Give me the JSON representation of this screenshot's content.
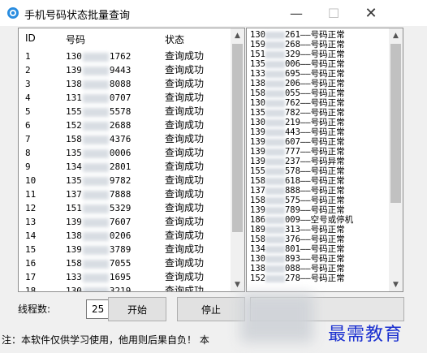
{
  "window": {
    "title": "手机号码状态批量查询"
  },
  "left_table": {
    "headers": {
      "id": "ID",
      "number": "号码",
      "status": "状态"
    },
    "rows": [
      {
        "id": "1",
        "prefix": "130",
        "suffix": "1762",
        "status": "查询成功"
      },
      {
        "id": "2",
        "prefix": "139",
        "suffix": "9443",
        "status": "查询成功"
      },
      {
        "id": "3",
        "prefix": "138",
        "suffix": "8088",
        "status": "查询成功"
      },
      {
        "id": "4",
        "prefix": "131",
        "suffix": "0707",
        "status": "查询成功"
      },
      {
        "id": "5",
        "prefix": "155",
        "suffix": "5578",
        "status": "查询成功"
      },
      {
        "id": "6",
        "prefix": "152",
        "suffix": "2688",
        "status": "查询成功"
      },
      {
        "id": "7",
        "prefix": "158",
        "suffix": "4376",
        "status": "查询成功"
      },
      {
        "id": "8",
        "prefix": "135",
        "suffix": "0006",
        "status": "查询成功"
      },
      {
        "id": "9",
        "prefix": "134",
        "suffix": "2801",
        "status": "查询成功"
      },
      {
        "id": "10",
        "prefix": "135",
        "suffix": "9782",
        "status": "查询成功"
      },
      {
        "id": "11",
        "prefix": "137",
        "suffix": "7888",
        "status": "查询成功"
      },
      {
        "id": "12",
        "prefix": "151",
        "suffix": "5329",
        "status": "查询成功"
      },
      {
        "id": "13",
        "prefix": "139",
        "suffix": "7607",
        "status": "查询成功"
      },
      {
        "id": "14",
        "prefix": "138",
        "suffix": "0206",
        "status": "查询成功"
      },
      {
        "id": "15",
        "prefix": "139",
        "suffix": "3789",
        "status": "查询成功"
      },
      {
        "id": "16",
        "prefix": "158",
        "suffix": "7055",
        "status": "查询成功"
      },
      {
        "id": "17",
        "prefix": "133",
        "suffix": "1695",
        "status": "查询成功"
      },
      {
        "id": "18",
        "prefix": "130",
        "suffix": "3219",
        "status": "查询成功"
      }
    ]
  },
  "right_log": {
    "lines": [
      {
        "prefix": "130",
        "tail": "261——号码正常"
      },
      {
        "prefix": "159",
        "tail": "268——号码正常"
      },
      {
        "prefix": "151",
        "tail": "329——号码正常"
      },
      {
        "prefix": "135",
        "tail": "006——号码正常"
      },
      {
        "prefix": "133",
        "tail": "695——号码正常"
      },
      {
        "prefix": "138",
        "tail": "206——号码正常"
      },
      {
        "prefix": "158",
        "tail": "055——号码正常"
      },
      {
        "prefix": "130",
        "tail": "762——号码正常"
      },
      {
        "prefix": "135",
        "tail": "782——号码正常"
      },
      {
        "prefix": "130",
        "tail": "219——号码正常"
      },
      {
        "prefix": "139",
        "tail": "443——号码正常"
      },
      {
        "prefix": "139",
        "tail": "607——号码正常"
      },
      {
        "prefix": "139",
        "tail": "777——号码正常"
      },
      {
        "prefix": "139",
        "tail": "237——号码异常"
      },
      {
        "prefix": "155",
        "tail": "578——号码正常"
      },
      {
        "prefix": "158",
        "tail": "618——号码正常"
      },
      {
        "prefix": "137",
        "tail": "888——号码正常"
      },
      {
        "prefix": "158",
        "tail": "575——号码正常"
      },
      {
        "prefix": "139",
        "tail": "789——号码正常"
      },
      {
        "prefix": "186",
        "tail": "009——空号或停机"
      },
      {
        "prefix": "189",
        "tail": "313——号码正常"
      },
      {
        "prefix": "158",
        "tail": "376——号码正常"
      },
      {
        "prefix": "134",
        "tail": "801——号码正常"
      },
      {
        "prefix": "130",
        "tail": "893——号码正常"
      },
      {
        "prefix": "138",
        "tail": "088——号码正常"
      },
      {
        "prefix": "152",
        "tail": "278——号码正常"
      }
    ]
  },
  "controls": {
    "threads_label": "线程数:",
    "threads_value": "25",
    "start_label": "开始",
    "stop_label": "停止",
    "export_label": ""
  },
  "status_bar": {
    "notice": "注：本软件仅供学习使用，他用则后果自负！  本"
  },
  "watermark": "最需教育"
}
